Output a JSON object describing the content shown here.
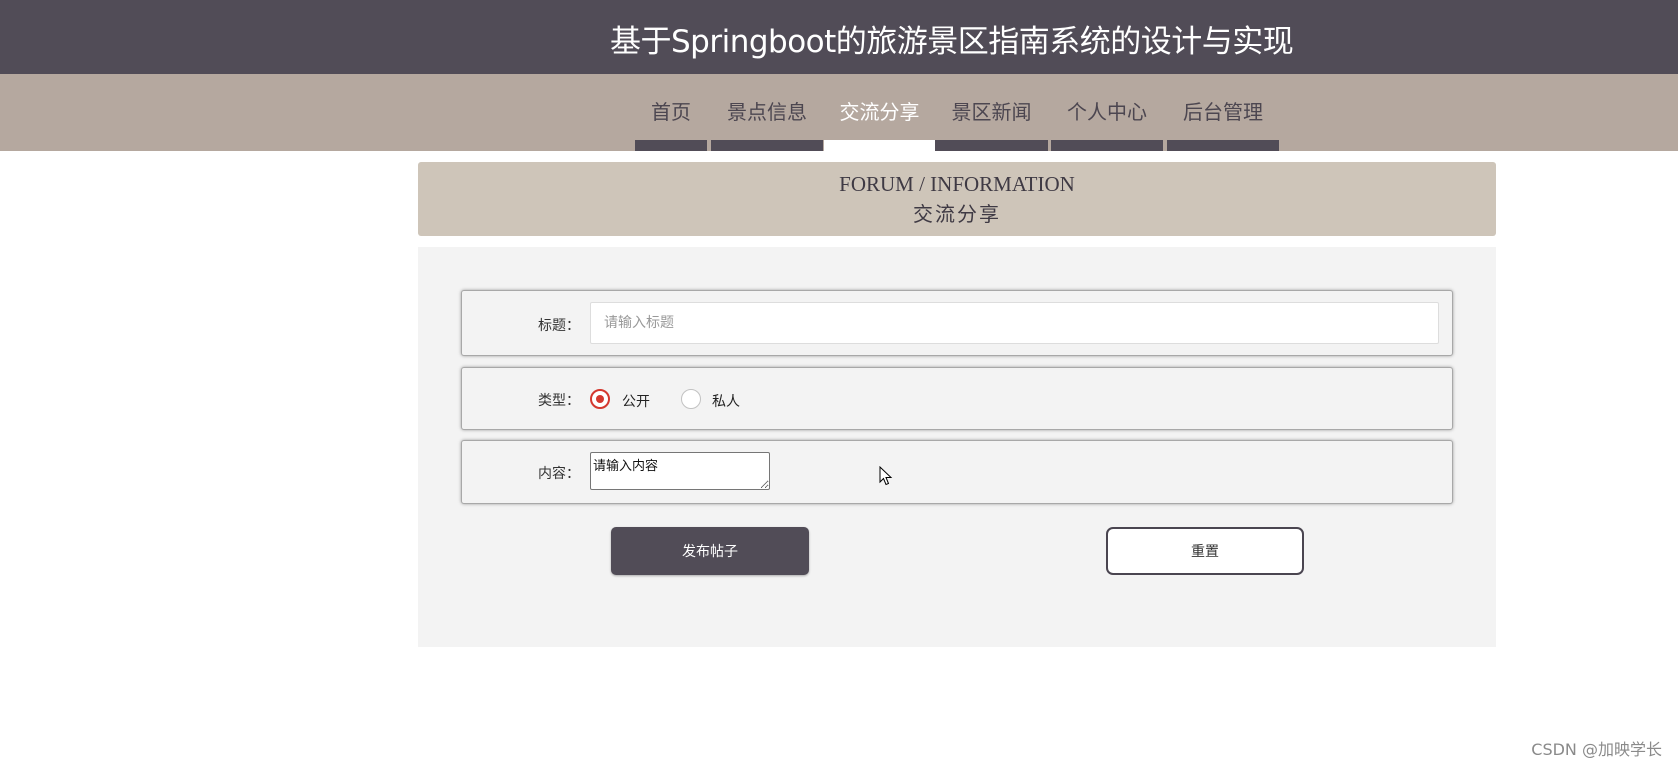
{
  "header": {
    "title": "基于Springboot的旅游景区指南系统的设计与实现"
  },
  "nav": {
    "items": [
      {
        "label": "首页",
        "active": false
      },
      {
        "label": "景点信息",
        "active": false
      },
      {
        "label": "交流分享",
        "active": true
      },
      {
        "label": "景区新闻",
        "active": false
      },
      {
        "label": "个人中心",
        "active": false
      },
      {
        "label": "后台管理",
        "active": false
      }
    ]
  },
  "banner": {
    "title_en": "FORUM / INFORMATION",
    "title_zh": "交流分享"
  },
  "form": {
    "title_label": "标题：",
    "title_placeholder": "请输入标题",
    "type_label": "类型：",
    "type_options": [
      {
        "label": "公开",
        "checked": true
      },
      {
        "label": "私人",
        "checked": false
      }
    ],
    "content_label": "内容：",
    "content_value": "请输入内容",
    "submit_label": "发布帖子",
    "reset_label": "重置"
  },
  "watermark": "CSDN @加映学长",
  "colors": {
    "header_bg": "#514c57",
    "nav_bg": "#b5a89f",
    "banner_bg": "#cec5b9",
    "panel_bg": "#f3f3f3",
    "radio_accent": "#d4382f"
  }
}
